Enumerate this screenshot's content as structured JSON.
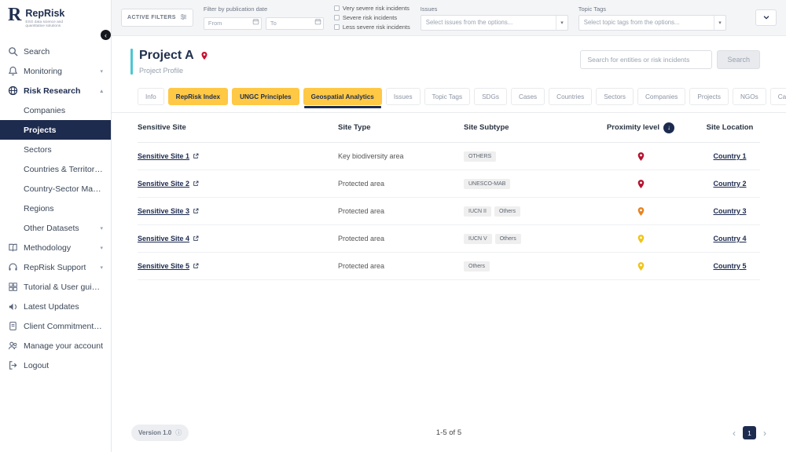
{
  "brand": {
    "name": "RepRisk",
    "tagline": "ESG data science and quantitative solutions"
  },
  "icons": {
    "add": "+",
    "sort_desc": "↓",
    "info": "ⓘ",
    "prev": "‹",
    "next": "›",
    "chevron_down": "▾",
    "chevron_up": "▴",
    "collapse_sidebar": "‹",
    "search": "search-icon",
    "bell": "bell-icon",
    "globe": "globe-icon",
    "book": "book-icon",
    "headset": "headset-icon",
    "grid": "grid-icon",
    "megaphone": "megaphone-icon",
    "document": "document-icon",
    "users": "users-icon",
    "logout": "logout-icon",
    "calendar": "calendar-icon",
    "sliders": "sliders-icon",
    "location_pin": "location-pin-icon",
    "external_link": "external-link-icon"
  },
  "colors": {
    "navy": "#1d2b4f",
    "yellow": "#ffc845",
    "teal": "#4cc6d4",
    "pin_red": "#b5122e",
    "pin_orange": "#e8821d",
    "pin_yellow": "#f0c419",
    "topbar_bg": "#f4f5f7",
    "chip_bg": "#efefef"
  },
  "sidebar": {
    "items": [
      {
        "label": "Search"
      },
      {
        "label": "Monitoring"
      },
      {
        "label": "Risk Research"
      },
      {
        "label": "Companies"
      },
      {
        "label": "Projects"
      },
      {
        "label": "Sectors"
      },
      {
        "label": "Countries & Territories"
      },
      {
        "label": "Country-Sector Matrix"
      },
      {
        "label": "Regions"
      },
      {
        "label": "Other Datasets"
      },
      {
        "label": "Methodology"
      },
      {
        "label": "RepRisk Support"
      },
      {
        "label": "Tutorial & User guides"
      },
      {
        "label": "Latest Updates"
      },
      {
        "label": "Client Commitment Charter"
      },
      {
        "label": "Manage your account"
      },
      {
        "label": "Logout"
      }
    ]
  },
  "filterbar": {
    "active_filters": "ACTIVE FILTERS",
    "publication_date_label": "Filter by publication date",
    "from_placeholder": "From",
    "to_placeholder": "To",
    "severities": [
      "Very severe risk incidents",
      "Severe risk incidents",
      "Less severe risk incidents"
    ],
    "issues_label": "Issues",
    "issues_placeholder": "Select issues from the options...",
    "topic_tags_label": "Topic Tags",
    "topic_tags_placeholder": "Select topic tags from the options..."
  },
  "header": {
    "title": "Project A",
    "subtitle": "Project Profile",
    "search_placeholder": "Search for entities or risk incidents",
    "search_button": "Search"
  },
  "tabs": [
    "Info",
    "RepRisk Index",
    "UNGC Principles",
    "Geospatial Analytics",
    "Issues",
    "Topic Tags",
    "SDGs",
    "Cases",
    "Countries",
    "Sectors",
    "Companies",
    "Projects",
    "NGOs",
    "Campaigns"
  ],
  "table": {
    "columns": [
      "Sensitive Site",
      "Site Type",
      "Site Subtype",
      "Proximity level",
      "Site Location"
    ],
    "rows": [
      {
        "site": "Sensitive Site 1",
        "type": "Key biodiversity area",
        "subtypes": [
          "OTHERS"
        ],
        "proximity": "red",
        "location": "Country 1"
      },
      {
        "site": "Sensitive Site 2",
        "type": "Protected area",
        "subtypes": [
          "UNESCO-MAB"
        ],
        "proximity": "red",
        "location": "Country 2"
      },
      {
        "site": "Sensitive Site 3",
        "type": "Protected area",
        "subtypes": [
          "IUCN II",
          "Others"
        ],
        "proximity": "orange",
        "location": "Country 3"
      },
      {
        "site": "Sensitive Site 4",
        "type": "Protected area",
        "subtypes": [
          "IUCN V",
          "Others"
        ],
        "proximity": "yellow",
        "location": "Country 4"
      },
      {
        "site": "Sensitive Site 5",
        "type": "Protected area",
        "subtypes": [
          "Others"
        ],
        "proximity": "yellow",
        "location": "Country 5"
      }
    ]
  },
  "footer": {
    "version": "Version 1.0",
    "range": "1-5 of 5",
    "page": "1"
  }
}
